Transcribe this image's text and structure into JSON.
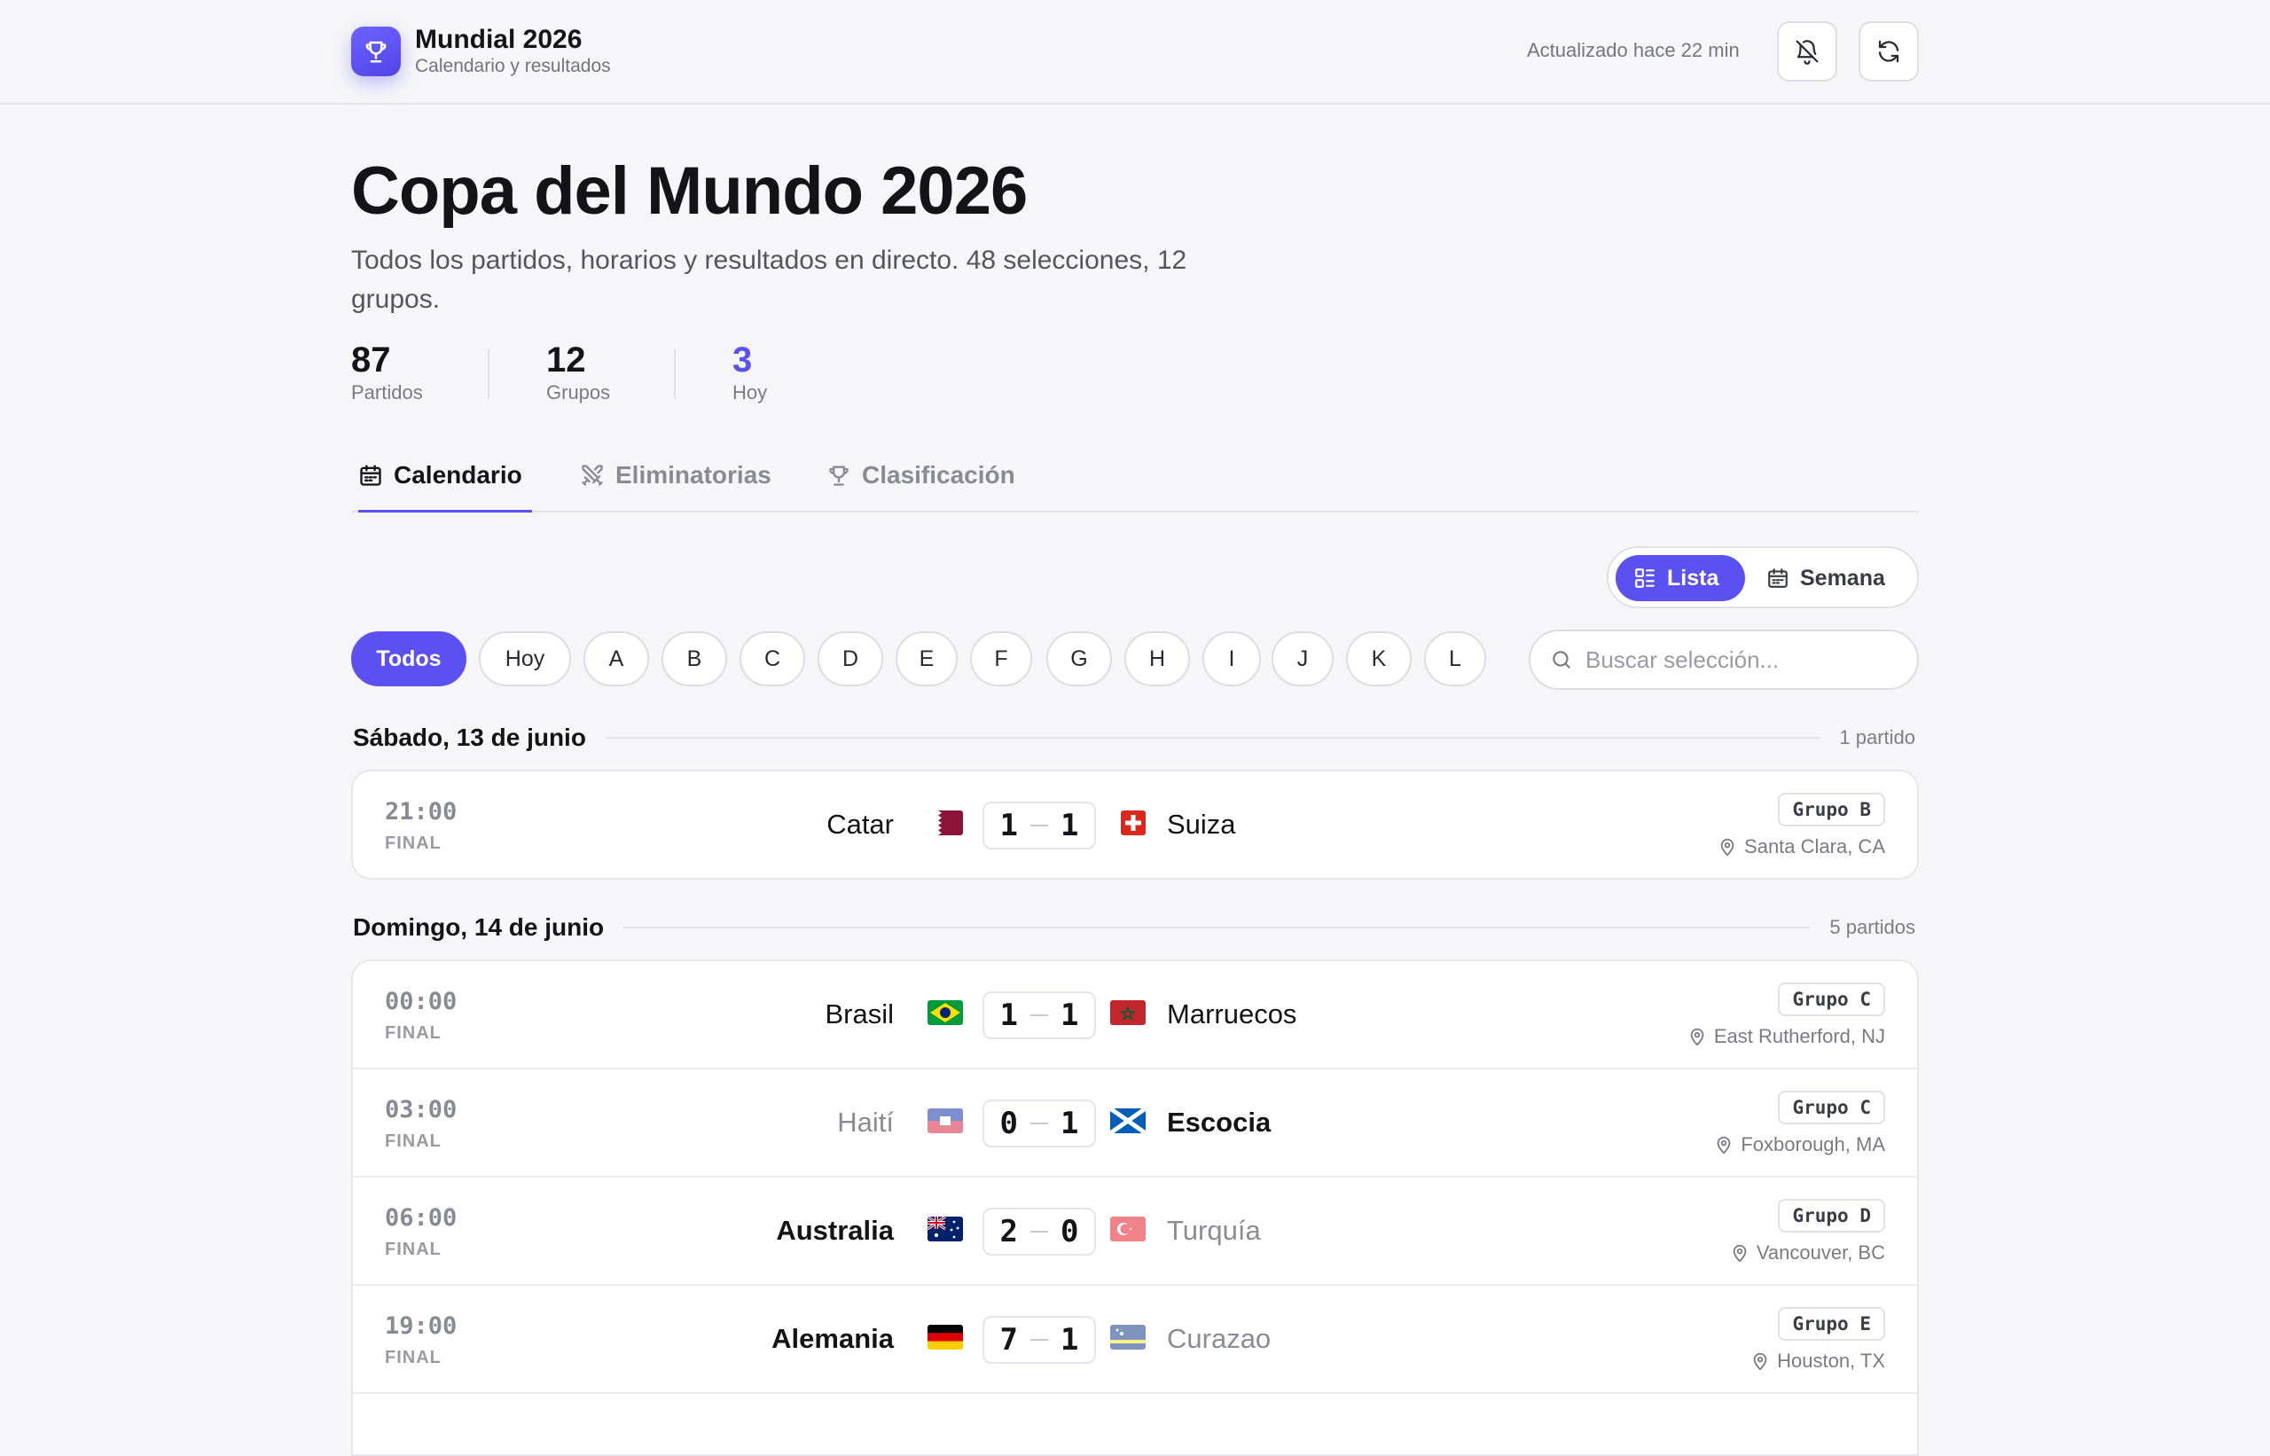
{
  "app": {
    "title": "Mundial 2026",
    "subtitle": "Calendario y resultados",
    "updated": "Actualizado hace 22 min"
  },
  "hero": {
    "title": "Copa del Mundo 2026",
    "description": "Todos los partidos, horarios y resultados en directo. 48 selecciones, 12 grupos."
  },
  "stats": [
    {
      "value": "87",
      "label": "Partidos"
    },
    {
      "value": "12",
      "label": "Grupos"
    },
    {
      "value": "3",
      "label": "Hoy",
      "color": "#5b50f0"
    }
  ],
  "tabs": [
    {
      "label": "Calendario",
      "icon": "calendar-icon",
      "active": true
    },
    {
      "label": "Eliminatorias",
      "icon": "swords-icon"
    },
    {
      "label": "Clasificación",
      "icon": "trophy-icon"
    }
  ],
  "view_toggle": {
    "list_label": "Lista",
    "week_label": "Semana",
    "selected": "Lista"
  },
  "filters": [
    "Todos",
    "Hoy",
    "A",
    "B",
    "C",
    "D",
    "E",
    "F",
    "G",
    "H",
    "I",
    "J",
    "K",
    "L"
  ],
  "active_filter": "Todos",
  "search": {
    "placeholder": "Buscar selección...",
    "value": ""
  },
  "days": [
    {
      "title": "Sábado, 13 de junio",
      "count": "1 partido",
      "matches": [
        {
          "time": "21:00",
          "status": "FINAL",
          "home": "Catar",
          "home_flag": "qatar-flag",
          "home_score": "1",
          "away_score": "1",
          "away": "Suiza",
          "away_flag": "switzerland-flag",
          "group": "Grupo B",
          "venue": "Santa Clara, CA"
        }
      ]
    },
    {
      "title": "Domingo, 14 de junio",
      "count": "5 partidos",
      "matches": [
        {
          "time": "00:00",
          "status": "FINAL",
          "home": "Brasil",
          "home_flag": "brazil-flag",
          "home_score": "1",
          "away_score": "1",
          "away": "Marruecos",
          "away_flag": "morocco-flag",
          "group": "Grupo C",
          "venue": "East Rutherford, NJ"
        },
        {
          "time": "03:00",
          "status": "FINAL",
          "home": "Haití",
          "home_flag": "haiti-flag",
          "home_score": "0",
          "away_score": "1",
          "away": "Escocia",
          "away_flag": "scotland-flag",
          "group": "Grupo C",
          "venue": "Foxborough, MA"
        },
        {
          "time": "06:00",
          "status": "FINAL",
          "home": "Australia",
          "home_flag": "australia-flag",
          "home_score": "2",
          "away_score": "0",
          "away": "Turquía",
          "away_flag": "turkey-flag",
          "group": "Grupo D",
          "venue": "Vancouver, BC"
        },
        {
          "time": "19:00",
          "status": "FINAL",
          "home": "Alemania",
          "home_flag": "germany-flag",
          "home_score": "7",
          "away_score": "1",
          "away": "Curazao",
          "away_flag": "curacao-flag",
          "group": "Grupo E",
          "venue": "Houston, TX"
        }
      ]
    }
  ],
  "colors": {
    "accent": "#5b50f0",
    "background": "#f6f6f8"
  }
}
